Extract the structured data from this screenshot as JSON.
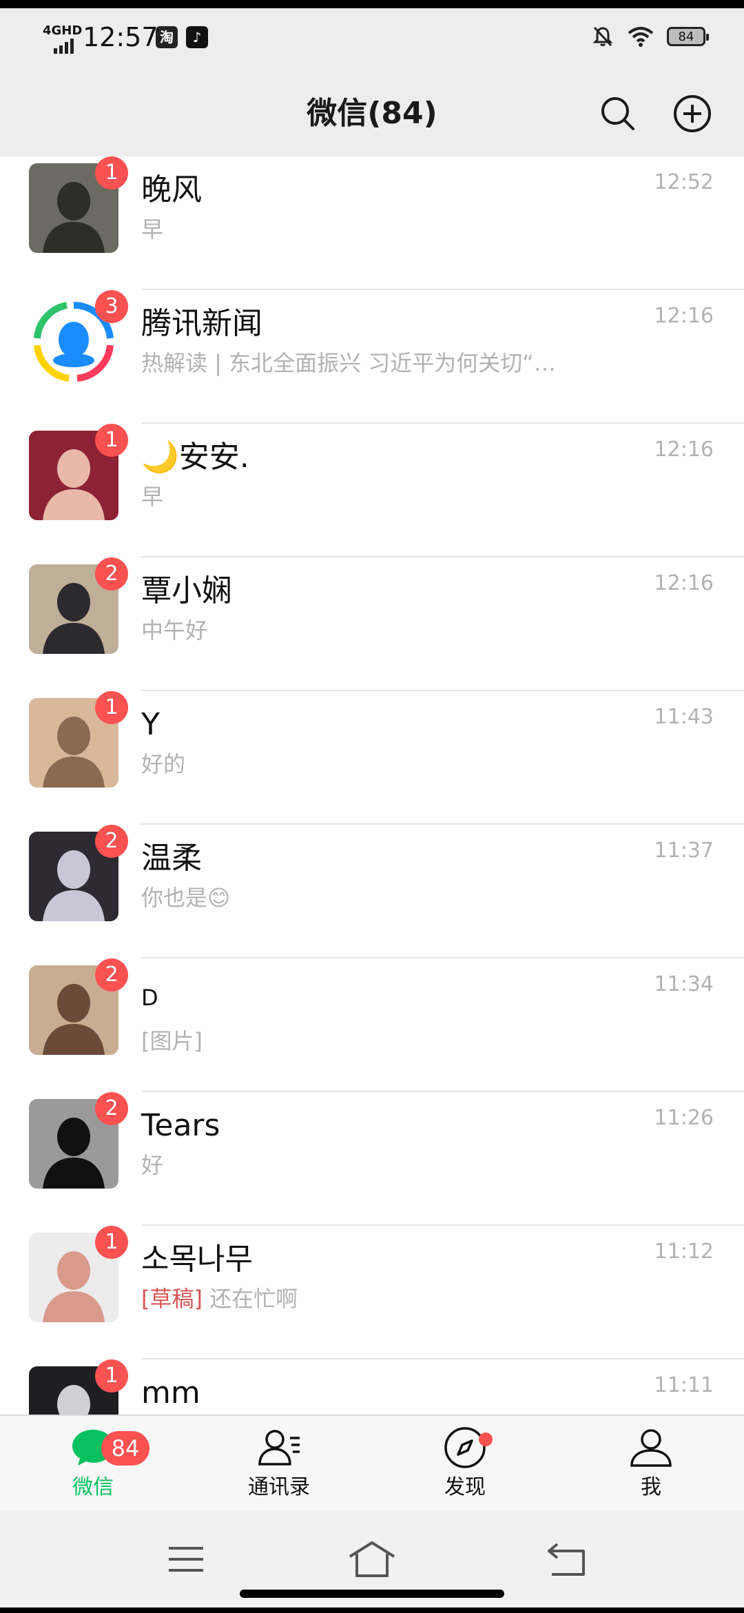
{
  "status_bar": {
    "network": "4GHD",
    "time": "12:57",
    "app_icon_1": "淘",
    "app_icon_2": "♪",
    "battery": "84"
  },
  "header": {
    "title": "微信(84)"
  },
  "chats": [
    {
      "name": "晚风",
      "preview": "早",
      "time": "12:52",
      "badge": "1",
      "avatar": {
        "bg": "#6b6b63",
        "fg": "#2d2d2a"
      }
    },
    {
      "name": "腾讯新闻",
      "preview": "热解读 | 东北全面振兴 习近平为何关切“…",
      "time": "12:16",
      "badge": "3",
      "avatar": {
        "bg": "#ffffff",
        "fg": "#1a8cff"
      }
    },
    {
      "name": "🌙安安.",
      "preview": "早",
      "time": "12:16",
      "badge": "1",
      "avatar": {
        "bg": "#8c2234",
        "fg": "#e8b9a8"
      }
    },
    {
      "name": "覃小娴",
      "preview": "中午好",
      "time": "12:16",
      "badge": "2",
      "avatar": {
        "bg": "#bfae98",
        "fg": "#2b2a2e"
      }
    },
    {
      "name": "Y",
      "preview": "好的",
      "time": "11:43",
      "badge": "1",
      "avatar": {
        "bg": "#d9b89a",
        "fg": "#8a6b52"
      }
    },
    {
      "name": "温柔",
      "preview": "你也是😊",
      "time": "11:37",
      "badge": "2",
      "avatar": {
        "bg": "#2e2a33",
        "fg": "#c9c7d6"
      }
    },
    {
      "name": "D",
      "preview": "[图片]",
      "time": "11:34",
      "badge": "2",
      "avatar": {
        "bg": "#c9ad92",
        "fg": "#6b4a39"
      }
    },
    {
      "name": "Tears",
      "preview": "好",
      "time": "11:26",
      "badge": "2",
      "avatar": {
        "bg": "#9a9a9a",
        "fg": "#111111"
      }
    },
    {
      "name": "소목나무",
      "draft": "[草稿]",
      "preview": "还在忙啊",
      "time": "11:12",
      "badge": "1",
      "avatar": {
        "bg": "#ececec",
        "fg": "#d99a8c"
      }
    },
    {
      "name": "mm",
      "preview": "",
      "time": "11:11",
      "badge": "1",
      "avatar": {
        "bg": "#1f1f22",
        "fg": "#cfcfd4"
      }
    }
  ],
  "tabs": [
    {
      "label": "微信",
      "badge": "84",
      "icon": "chat-bubble-icon",
      "active": true
    },
    {
      "label": "通讯录",
      "icon": "contacts-icon"
    },
    {
      "label": "发现",
      "icon": "compass-icon",
      "dot": true
    },
    {
      "label": "我",
      "icon": "person-icon"
    }
  ],
  "colors": {
    "accent": "#07c160",
    "badge": "#fa5151",
    "header_bg": "#ededed"
  }
}
